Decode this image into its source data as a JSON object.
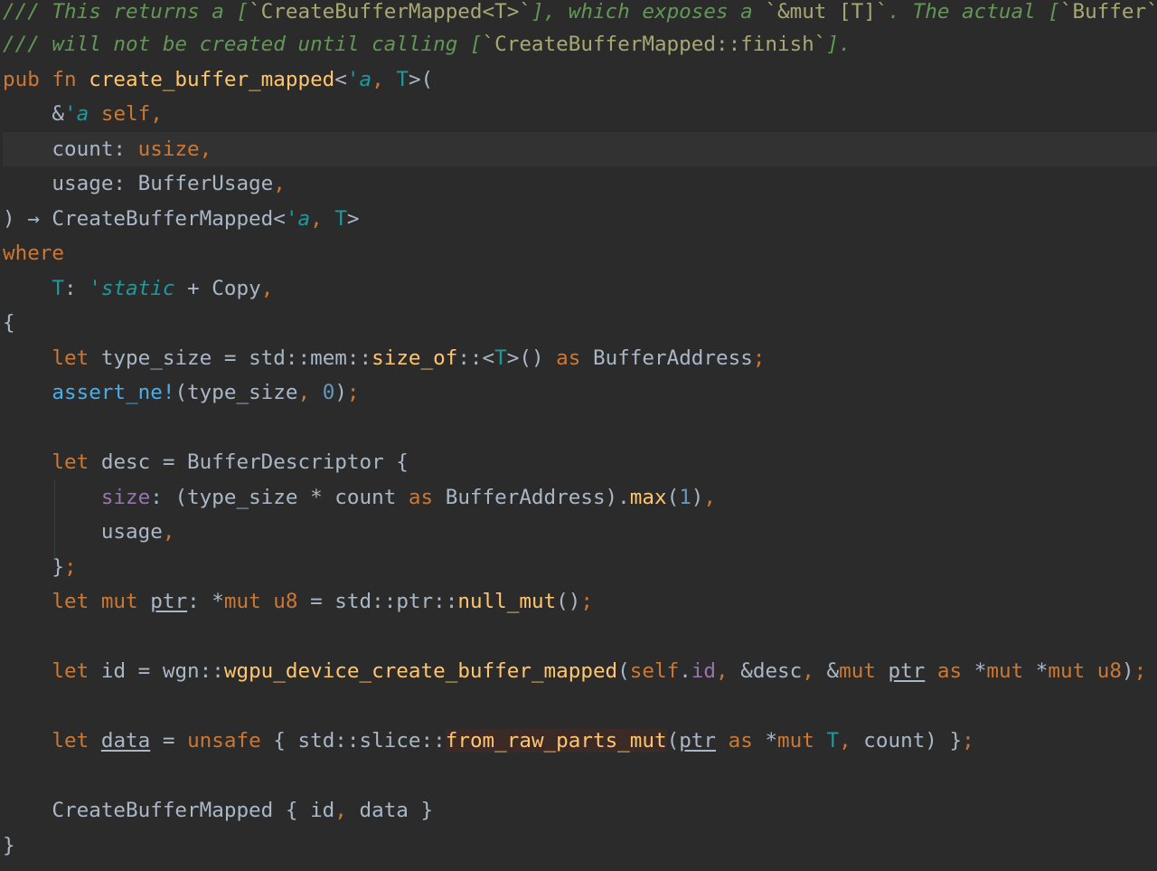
{
  "lines": [
    [
      {
        "t": "/// This returns a [",
        "c": "doc"
      },
      {
        "t": "`CreateBufferMapped<T>`",
        "c": "docl"
      },
      {
        "t": "], which exposes a ",
        "c": "doc"
      },
      {
        "t": "`&mut [T]`",
        "c": "docl"
      },
      {
        "t": ". The actual [",
        "c": "doc"
      },
      {
        "t": "`Buffer`",
        "c": "docl"
      },
      {
        "t": "]",
        "c": "doc"
      }
    ],
    [
      {
        "t": "/// will not be created until calling [",
        "c": "doc"
      },
      {
        "t": "`CreateBufferMapped::finish`",
        "c": "docl"
      },
      {
        "t": "].",
        "c": "doc"
      }
    ],
    [
      {
        "t": "pub fn ",
        "c": "kw"
      },
      {
        "t": "create_buffer_mapped",
        "c": "fn"
      },
      {
        "t": "<",
        "c": "dflt"
      },
      {
        "t": "'a",
        "c": "lt"
      },
      {
        "t": ", ",
        "c": "punc"
      },
      {
        "t": "T",
        "c": "tp"
      },
      {
        "t": ">(",
        "c": "dflt"
      }
    ],
    [
      {
        "t": "    &",
        "c": "dflt"
      },
      {
        "t": "'a",
        "c": "lt"
      },
      {
        "t": " self",
        "c": "kw"
      },
      {
        "t": ",",
        "c": "punc"
      }
    ],
    [
      {
        "t": "    count: ",
        "c": "dflt"
      },
      {
        "t": "usize",
        "c": "kw"
      },
      {
        "t": ",",
        "c": "punc"
      }
    ],
    [
      {
        "t": "    usage: BufferUsage",
        "c": "dflt"
      },
      {
        "t": ",",
        "c": "punc"
      }
    ],
    [
      {
        "t": ") → CreateBufferMapped<",
        "c": "dflt"
      },
      {
        "t": "'a",
        "c": "lt"
      },
      {
        "t": ", ",
        "c": "punc"
      },
      {
        "t": "T",
        "c": "tp"
      },
      {
        "t": ">",
        "c": "dflt"
      }
    ],
    [
      {
        "t": "where",
        "c": "kw"
      }
    ],
    [
      {
        "t": "    ",
        "c": "dflt"
      },
      {
        "t": "T",
        "c": "tp"
      },
      {
        "t": ": ",
        "c": "dflt"
      },
      {
        "t": "'static",
        "c": "lt"
      },
      {
        "t": " + Copy",
        "c": "dflt"
      },
      {
        "t": ",",
        "c": "punc"
      }
    ],
    [
      {
        "t": "{",
        "c": "dflt"
      }
    ],
    [
      {
        "t": "    ",
        "c": "dflt"
      },
      {
        "t": "let ",
        "c": "kw"
      },
      {
        "t": "type_size = std::mem::",
        "c": "dflt"
      },
      {
        "t": "size_of",
        "c": "fn"
      },
      {
        "t": "::<",
        "c": "dflt"
      },
      {
        "t": "T",
        "c": "tp"
      },
      {
        "t": ">() ",
        "c": "dflt"
      },
      {
        "t": "as ",
        "c": "kw"
      },
      {
        "t": "BufferAddress",
        "c": "dflt"
      },
      {
        "t": ";",
        "c": "punc"
      }
    ],
    [
      {
        "t": "    ",
        "c": "dflt"
      },
      {
        "t": "assert_ne!",
        "c": "mac"
      },
      {
        "t": "(type_size",
        "c": "dflt"
      },
      {
        "t": ", ",
        "c": "punc"
      },
      {
        "t": "0",
        "c": "num"
      },
      {
        "t": ")",
        "c": "dflt"
      },
      {
        "t": ";",
        "c": "punc"
      }
    ],
    [],
    [
      {
        "t": "    ",
        "c": "dflt"
      },
      {
        "t": "let ",
        "c": "kw"
      },
      {
        "t": "desc = BufferDescriptor {",
        "c": "dflt"
      }
    ],
    [
      {
        "t": "        ",
        "c": "dflt"
      },
      {
        "t": "size",
        "c": "fld"
      },
      {
        "t": ": (type_size * count ",
        "c": "dflt"
      },
      {
        "t": "as ",
        "c": "kw"
      },
      {
        "t": "BufferAddress).",
        "c": "dflt"
      },
      {
        "t": "max",
        "c": "fn"
      },
      {
        "t": "(",
        "c": "dflt"
      },
      {
        "t": "1",
        "c": "num"
      },
      {
        "t": ")",
        "c": "dflt"
      },
      {
        "t": ",",
        "c": "punc"
      }
    ],
    [
      {
        "t": "        usage",
        "c": "dflt"
      },
      {
        "t": ",",
        "c": "punc"
      }
    ],
    [
      {
        "t": "    }",
        "c": "dflt"
      },
      {
        "t": ";",
        "c": "punc"
      }
    ],
    [
      {
        "t": "    ",
        "c": "dflt"
      },
      {
        "t": "let mut ",
        "c": "kw"
      },
      {
        "t": "ptr",
        "c": "uline"
      },
      {
        "t": ": *",
        "c": "dflt"
      },
      {
        "t": "mut u8",
        "c": "kw"
      },
      {
        "t": " = std::ptr::",
        "c": "dflt"
      },
      {
        "t": "null_mut",
        "c": "fn"
      },
      {
        "t": "()",
        "c": "dflt"
      },
      {
        "t": ";",
        "c": "punc"
      }
    ],
    [],
    [
      {
        "t": "    ",
        "c": "dflt"
      },
      {
        "t": "let ",
        "c": "kw"
      },
      {
        "t": "id = wgn::",
        "c": "dflt"
      },
      {
        "t": "wgpu_device_create_buffer_mapped",
        "c": "fn"
      },
      {
        "t": "(",
        "c": "dflt"
      },
      {
        "t": "self",
        "c": "slf"
      },
      {
        "t": ".",
        "c": "dflt"
      },
      {
        "t": "id",
        "c": "fld"
      },
      {
        "t": ", ",
        "c": "punc"
      },
      {
        "t": "&desc",
        "c": "dflt"
      },
      {
        "t": ", ",
        "c": "punc"
      },
      {
        "t": "&",
        "c": "dflt"
      },
      {
        "t": "mut ",
        "c": "kw"
      },
      {
        "t": "ptr",
        "c": "uline"
      },
      {
        "t": " as ",
        "c": "kw"
      },
      {
        "t": "*",
        "c": "dflt"
      },
      {
        "t": "mut ",
        "c": "kw"
      },
      {
        "t": "*",
        "c": "dflt"
      },
      {
        "t": "mut u8",
        "c": "kw"
      },
      {
        "t": ")",
        "c": "dflt"
      },
      {
        "t": ";",
        "c": "punc"
      }
    ],
    [],
    [
      {
        "t": "    ",
        "c": "dflt"
      },
      {
        "t": "let ",
        "c": "kw"
      },
      {
        "t": "data",
        "c": "uline"
      },
      {
        "t": " = ",
        "c": "dflt"
      },
      {
        "t": "unsafe ",
        "c": "kw"
      },
      {
        "t": "{ std::slice::",
        "c": "dflt"
      },
      {
        "t": "from_raw_parts_mut",
        "c": "hl"
      },
      {
        "t": "(",
        "c": "dflt"
      },
      {
        "t": "ptr",
        "c": "uline"
      },
      {
        "t": " as ",
        "c": "kw"
      },
      {
        "t": "*",
        "c": "dflt"
      },
      {
        "t": "mut ",
        "c": "kw"
      },
      {
        "t": "T",
        "c": "tp"
      },
      {
        "t": ", ",
        "c": "punc"
      },
      {
        "t": "count) }",
        "c": "dflt"
      },
      {
        "t": ";",
        "c": "punc"
      }
    ],
    [],
    [
      {
        "t": "    CreateBufferMapped { id",
        "c": "dflt"
      },
      {
        "t": ", ",
        "c": "punc"
      },
      {
        "t": "data }",
        "c": "dflt"
      }
    ],
    [
      {
        "t": "}",
        "c": "dflt"
      }
    ]
  ],
  "current_line": 4,
  "colors": {
    "background": "#2b2b2b",
    "current_line": "#323232",
    "doc_comment": "#629755",
    "keyword": "#cc7832",
    "function": "#ffc66d",
    "lifetime": "#20999d",
    "macro": "#4eade5",
    "number": "#6897bb",
    "field": "#9876aa",
    "text": "#a9b7c6",
    "highlight": "#3b2a26"
  }
}
